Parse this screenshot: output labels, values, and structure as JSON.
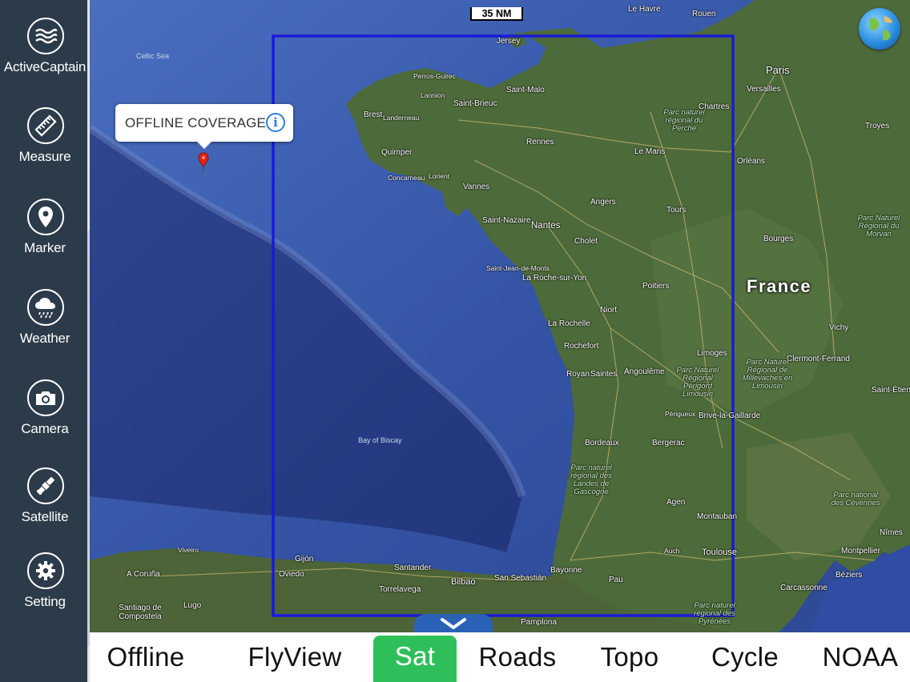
{
  "sidebar": {
    "items": [
      {
        "label": "ActiveCaptain",
        "icon": "waves-icon"
      },
      {
        "label": "Measure",
        "icon": "ruler-icon"
      },
      {
        "label": "Marker",
        "icon": "location-pin-icon"
      },
      {
        "label": "Weather",
        "icon": "rain-cloud-icon"
      },
      {
        "label": "Camera",
        "icon": "camera-icon"
      },
      {
        "label": "Satellite",
        "icon": "satellite-icon"
      },
      {
        "label": "Setting",
        "icon": "gear-icon"
      }
    ]
  },
  "map": {
    "scale_label": "35 NM",
    "coverage_label": "OFFLINE COVERAGE",
    "country_label": "France",
    "coverage_color": "#1a1ad8",
    "places": [
      "Celtic Sea",
      "Bay of Biscay",
      "Jersey",
      "Le Havre",
      "Rouen",
      "Paris",
      "Versailles",
      "Perros-Guirec",
      "Lannion",
      "Saint-Brieuc",
      "Saint-Malo",
      "Brest",
      "Landerneau",
      "Quimper",
      "Concarneau",
      "Lorient",
      "Vannes",
      "Rennes",
      "Le Mans",
      "Chartres",
      "Orléans",
      "Troyes",
      "Angers",
      "Tours",
      "Saint-Nazaire",
      "Nantes",
      "Cholet",
      "Bourges",
      "Saint-Jean-de-Monts",
      "La Roche-sur-Yon",
      "Poitiers",
      "Niort",
      "La Rochelle",
      "Rochefort",
      "Limoges",
      "Vichy",
      "Royan",
      "Saintes",
      "Angoulême",
      "Clermont-Ferrand",
      "Périgueux",
      "Brive-la-Gaillarde",
      "Saint-Étienne",
      "Bordeaux",
      "Bergerac",
      "Agen",
      "Montauban",
      "Toulouse",
      "Auch",
      "Bayonne",
      "Pau",
      "Nîmes",
      "Montpellier",
      "Béziers",
      "Carcassonne",
      "Gijón",
      "Oviedo",
      "Santander",
      "Bilbao",
      "San Sebastián",
      "Torrelavega",
      "Pamplona",
      "A Coruña",
      "Lugo",
      "Santiago de Compostela",
      "Viveiro"
    ],
    "parks": [
      "Parc naturel régional du Perche",
      "Parc Naturel Régional du Morvan",
      "Parc Naturel Régional de Millevaches en Limousin",
      "Parc Naturel Régional Périgord Limousin",
      "Parc naturel régional des Landes de Gascogne",
      "Parc national des Cévennes",
      "Parc naturel régional des Pyrénées"
    ]
  },
  "tabs": [
    {
      "label": "Offline",
      "active": false
    },
    {
      "label": "FlyView",
      "active": false
    },
    {
      "label": "Sat",
      "active": true
    },
    {
      "label": "Roads",
      "active": false
    },
    {
      "label": "Topo",
      "active": false
    },
    {
      "label": "Cycle",
      "active": false
    },
    {
      "label": "NOAA",
      "active": false
    }
  ],
  "colors": {
    "sidebar_bg": "#2c3b4a",
    "active_tab": "#2fbf5a",
    "sea": "#3a5aa8",
    "land": "#4a6a36"
  }
}
